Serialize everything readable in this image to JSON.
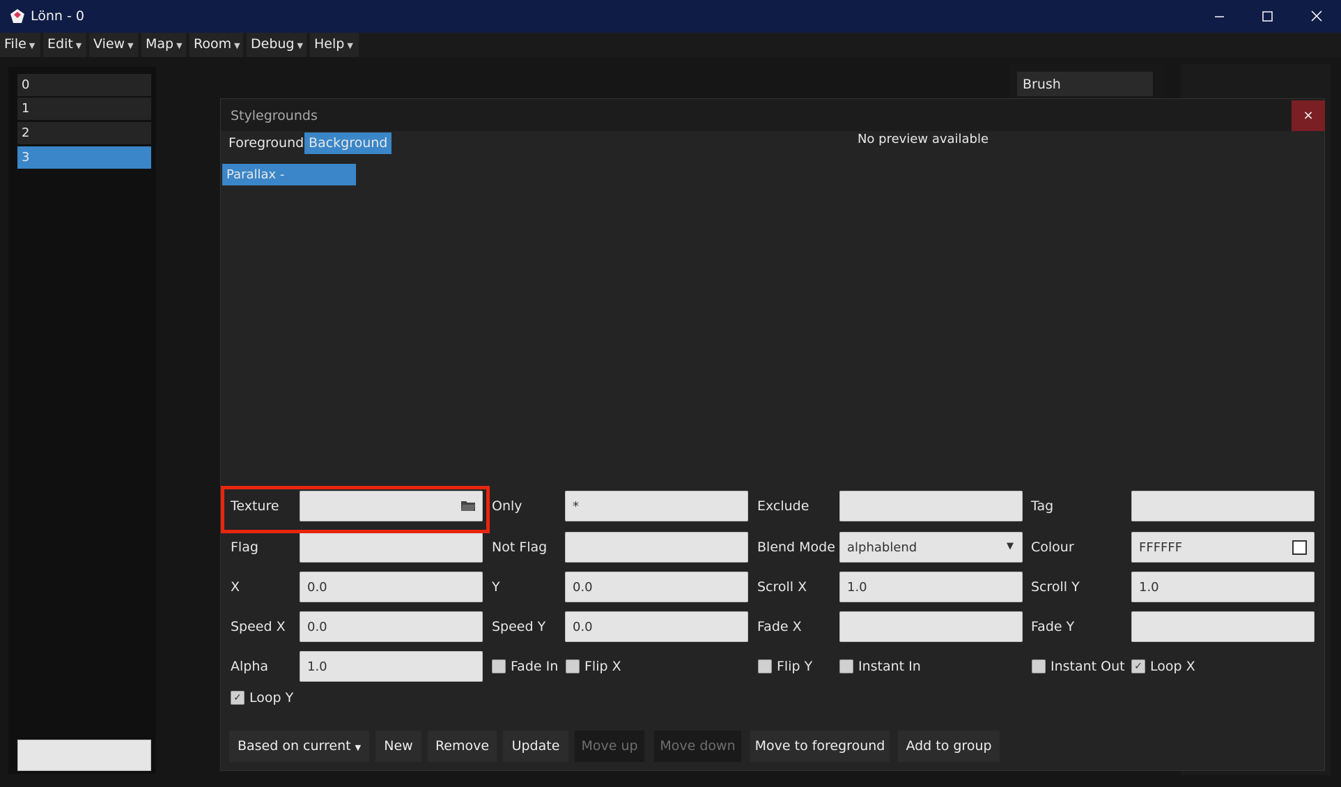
{
  "window": {
    "title": "Lönn - 0",
    "minimize_icon": "minimize-icon",
    "maximize_icon": "maximize-icon",
    "close_icon": "close-icon"
  },
  "menu": {
    "items": [
      {
        "label": "File"
      },
      {
        "label": "Edit"
      },
      {
        "label": "View"
      },
      {
        "label": "Map"
      },
      {
        "label": "Room"
      },
      {
        "label": "Debug"
      },
      {
        "label": "Help"
      }
    ]
  },
  "rooms": {
    "items": [
      "0",
      "1",
      "2",
      "3"
    ],
    "selected": "3",
    "search_value": ""
  },
  "brush": {
    "label": "Brush"
  },
  "dialog": {
    "title": "Stylegrounds",
    "close_symbol": "×",
    "tabs": {
      "foreground": "Foreground",
      "background": "Background",
      "active": "Background"
    },
    "preview_text": "No preview available",
    "list": {
      "items": [
        "Parallax -"
      ],
      "selected": "Parallax -"
    },
    "fields": {
      "texture": {
        "label": "Texture",
        "value": ""
      },
      "only": {
        "label": "Only",
        "value": "*"
      },
      "exclude": {
        "label": "Exclude",
        "value": ""
      },
      "tag": {
        "label": "Tag",
        "value": ""
      },
      "flag": {
        "label": "Flag",
        "value": ""
      },
      "not_flag": {
        "label": "Not Flag",
        "value": ""
      },
      "blend_mode": {
        "label": "Blend Mode",
        "value": "alphablend"
      },
      "colour": {
        "label": "Colour",
        "value": "FFFFFF",
        "swatch": "#FFFFFF"
      },
      "x": {
        "label": "X",
        "value": "0.0"
      },
      "y": {
        "label": "Y",
        "value": "0.0"
      },
      "scroll_x": {
        "label": "Scroll X",
        "value": "1.0"
      },
      "scroll_y": {
        "label": "Scroll Y",
        "value": "1.0"
      },
      "speed_x": {
        "label": "Speed X",
        "value": "0.0"
      },
      "speed_y": {
        "label": "Speed Y",
        "value": "0.0"
      },
      "fade_x": {
        "label": "Fade X",
        "value": ""
      },
      "fade_y": {
        "label": "Fade Y",
        "value": ""
      },
      "alpha": {
        "label": "Alpha",
        "value": "1.0"
      }
    },
    "checkboxes": {
      "fade_in": {
        "label": "Fade In",
        "checked": false
      },
      "flip_x": {
        "label": "Flip X",
        "checked": false
      },
      "flip_y": {
        "label": "Flip Y",
        "checked": false
      },
      "instant_in": {
        "label": "Instant In",
        "checked": false
      },
      "instant_out": {
        "label": "Instant Out",
        "checked": false
      },
      "loop_x": {
        "label": "Loop X",
        "checked": true
      },
      "loop_y": {
        "label": "Loop Y",
        "checked": true
      }
    },
    "buttons": {
      "based_on_current": "Based on current",
      "new": "New",
      "remove": "Remove",
      "update": "Update",
      "move_up": "Move up",
      "move_down": "Move down",
      "move_to_foreground": "Move to foreground",
      "add_to_group": "Add to group"
    }
  },
  "colors": {
    "accent": "#3a86c8",
    "highlight": "#e8260f",
    "close_bg": "#7a1f24"
  }
}
